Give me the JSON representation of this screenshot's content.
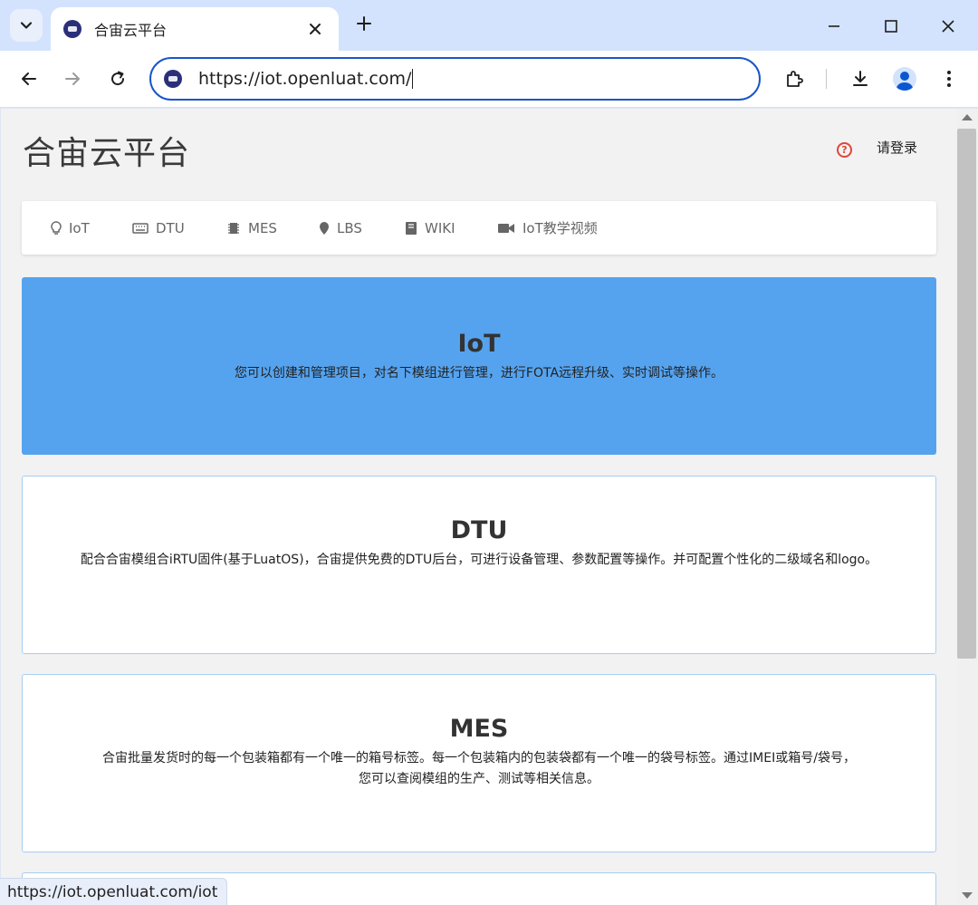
{
  "browser": {
    "tab_title": "合宙云平台",
    "url": "https://iot.openluat.com/",
    "status_url": "https://iot.openluat.com/iot"
  },
  "header": {
    "site_title": "合宙云平台",
    "login_label": "请登录"
  },
  "menu": {
    "items": [
      {
        "label": "IoT",
        "icon": "lightbulb-icon"
      },
      {
        "label": "DTU",
        "icon": "keyboard-icon"
      },
      {
        "label": "MES",
        "icon": "chip-icon"
      },
      {
        "label": "LBS",
        "icon": "map-marker-icon"
      },
      {
        "label": "WIKI",
        "icon": "book-icon"
      },
      {
        "label": "IoT教学视频",
        "icon": "video-camera-icon"
      }
    ]
  },
  "cards": [
    {
      "title": "IoT",
      "desc": "您可以创建和管理项目，对名下模组进行管理，进行FOTA远程升级、实时调试等操作。"
    },
    {
      "title": "DTU",
      "desc": "配合合宙模组合iRTU固件(基于LuatOS)，合宙提供免费的DTU后台，可进行设备管理、参数配置等操作。并可配置个性化的二级域名和logo。"
    },
    {
      "title": "MES",
      "desc_line1": "合宙批量发货时的每一个包装箱都有一个唯一的箱号标签。每一个包装箱内的包装袋都有一个唯一的袋号标签。通过IMEI或箱号/袋号，",
      "desc_line2": "您可以查阅模组的生产、测试等相关信息。"
    }
  ],
  "colors": {
    "iot_card": "#55a3ef",
    "card_border": "#a8cdf2",
    "omnibox_focus": "#1a56c9"
  }
}
